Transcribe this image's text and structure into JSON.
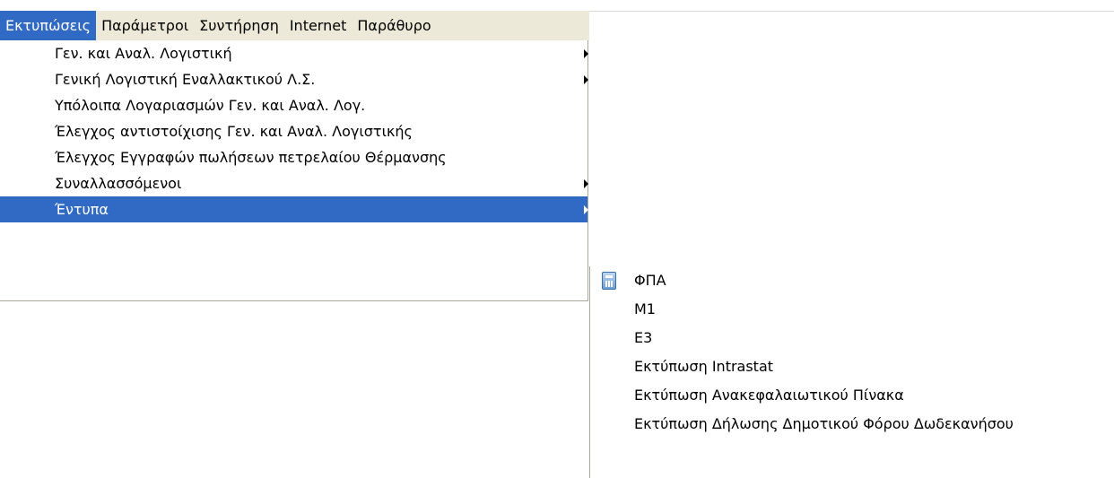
{
  "menubar": {
    "items": [
      {
        "label": "Εκτυπώσεις",
        "active": true
      },
      {
        "label": "Παράμετροι"
      },
      {
        "label": "Συντήρηση"
      },
      {
        "label": "Internet"
      },
      {
        "label": "Παράθυρο"
      }
    ]
  },
  "menu": {
    "items": [
      {
        "label": "Γεν. και Αναλ. Λογιστική",
        "submenu": true
      },
      {
        "label": "Γενική Λογιστική Εναλλακτικού Λ.Σ.",
        "submenu": true
      },
      {
        "label": "Υπόλοιπα Λογαριασμών Γεν. και Αναλ. Λογ."
      },
      {
        "label": "Έλεγχος αντιστοίχισης Γεν. και Αναλ. Λογιστικής"
      },
      {
        "label": "Έλεγχος Εγγραφών πωλήσεων πετρελαίου Θέρμανσης"
      },
      {
        "label": "Συναλλασσόμενοι",
        "submenu": true
      },
      {
        "label": "Έντυπα",
        "submenu": true,
        "highlighted": true
      }
    ]
  },
  "submenu": {
    "items": [
      {
        "label": "ΦΠΑ",
        "icon": "calculator-icon"
      },
      {
        "label": "Μ1"
      },
      {
        "label": "Ε3"
      },
      {
        "label": "Εκτύπωση Intrastat"
      },
      {
        "label": "Εκτύπωση Ανακεφαλαιωτικού Πίνακα"
      },
      {
        "label": "Εκτύπωση Δήλωσης Δημοτικού Φόρου Δωδεκανήσου"
      }
    ]
  },
  "colors": {
    "highlight": "#316ac5",
    "menubar_bg": "#ece9d8",
    "menu_bg": "#ffffff"
  }
}
